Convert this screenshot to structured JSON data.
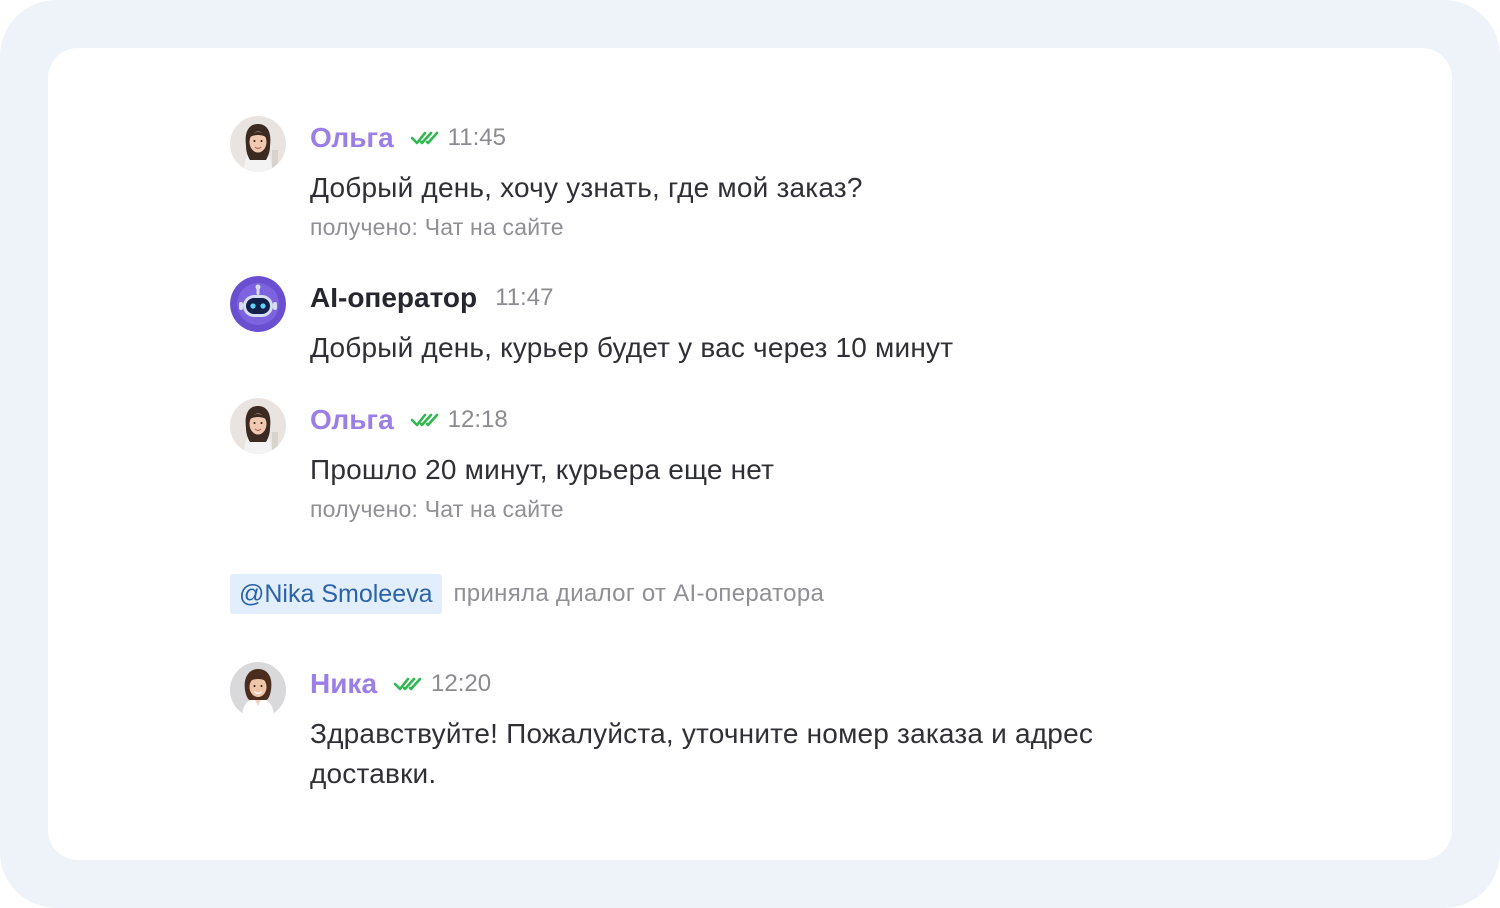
{
  "messages": [
    {
      "author": "Ольга",
      "time": "11:45",
      "text": "Добрый день, хочу узнать, где мой заказ?",
      "meta": "получено: Чат на сайте",
      "status_icon": "double-check-icon"
    },
    {
      "author": "AI-оператор",
      "time": "11:47",
      "text": "Добрый день, курьер будет у вас через 10 минут"
    },
    {
      "author": "Ольга",
      "time": "12:18",
      "text": "Прошло 20 минут, курьера еще нет",
      "meta": "получено: Чат на сайте",
      "status_icon": "double-check-icon"
    },
    {
      "author": "Ника",
      "time": "12:20",
      "text": "Здравствуйте! Пожалуйста, уточните номер заказа и адрес доставки.",
      "status_icon": "double-check-icon"
    }
  ],
  "system_event": {
    "mention": "@Nika Smoleeva",
    "text": "приняла диалог от AI-оператора"
  },
  "colors": {
    "background": "#eef3fa",
    "card": "#ffffff",
    "customer_name": "#9b7fe6",
    "check_mark": "#2fb84f",
    "mention_bg": "#e2eefc",
    "mention_text": "#2a63a8",
    "bot_avatar": "#6a4fd0"
  }
}
